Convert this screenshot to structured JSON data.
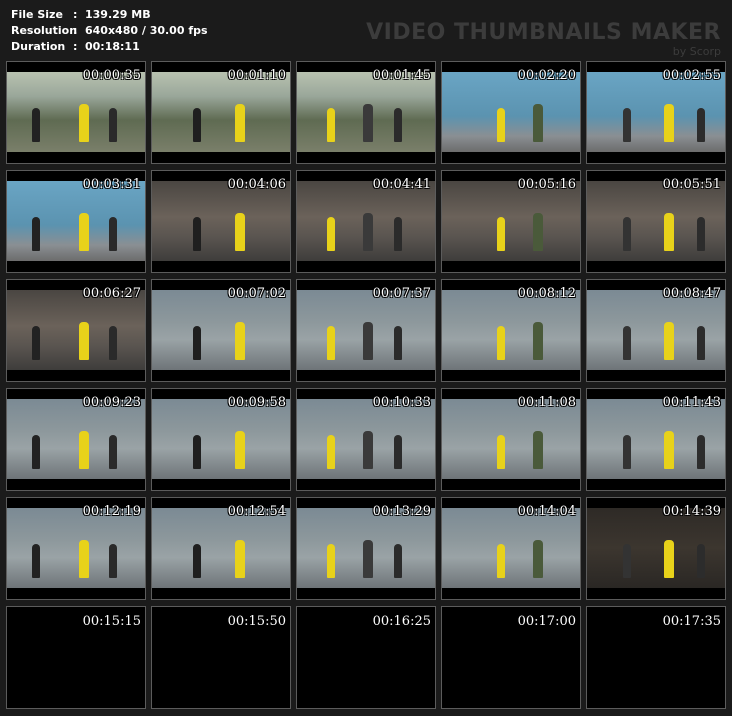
{
  "info": {
    "file_size_label": "File Size",
    "file_size_value": "139.29 MB",
    "resolution_label": "Resolution",
    "resolution_value": "640x480 / 30.00 fps",
    "duration_label": "Duration",
    "duration_value": "00:18:11",
    "separator": ":"
  },
  "brand": {
    "name": "VIDEO THUMBNAILS MAKER",
    "by": "by Scorp"
  },
  "thumbnails": [
    {
      "time": "00:00:35",
      "scene": "outdoor",
      "has_image": true
    },
    {
      "time": "00:01:10",
      "scene": "outdoor",
      "has_image": true
    },
    {
      "time": "00:01:45",
      "scene": "outdoor",
      "has_image": true
    },
    {
      "time": "00:02:20",
      "scene": "wall",
      "has_image": true
    },
    {
      "time": "00:02:55",
      "scene": "wall",
      "has_image": true
    },
    {
      "time": "00:03:31",
      "scene": "wall",
      "has_image": true
    },
    {
      "time": "00:04:06",
      "scene": "room",
      "has_image": true
    },
    {
      "time": "00:04:41",
      "scene": "room",
      "has_image": true
    },
    {
      "time": "00:05:16",
      "scene": "room",
      "has_image": true
    },
    {
      "time": "00:05:51",
      "scene": "room",
      "has_image": true
    },
    {
      "time": "00:06:27",
      "scene": "room",
      "has_image": true
    },
    {
      "time": "00:07:02",
      "scene": "hall",
      "has_image": true
    },
    {
      "time": "00:07:37",
      "scene": "hall",
      "has_image": true
    },
    {
      "time": "00:08:12",
      "scene": "hall",
      "has_image": true
    },
    {
      "time": "00:08:47",
      "scene": "hall",
      "has_image": true
    },
    {
      "time": "00:09:23",
      "scene": "hall",
      "has_image": true
    },
    {
      "time": "00:09:58",
      "scene": "hall",
      "has_image": true
    },
    {
      "time": "00:10:33",
      "scene": "hall",
      "has_image": true
    },
    {
      "time": "00:11:08",
      "scene": "hall",
      "has_image": true
    },
    {
      "time": "00:11:43",
      "scene": "hall",
      "has_image": true
    },
    {
      "time": "00:12:19",
      "scene": "hall",
      "has_image": true
    },
    {
      "time": "00:12:54",
      "scene": "hall",
      "has_image": true
    },
    {
      "time": "00:13:29",
      "scene": "hall",
      "has_image": true
    },
    {
      "time": "00:14:04",
      "scene": "hall",
      "has_image": true
    },
    {
      "time": "00:14:39",
      "scene": "dark",
      "has_image": true
    },
    {
      "time": "00:15:15",
      "scene": "none",
      "has_image": false
    },
    {
      "time": "00:15:50",
      "scene": "none",
      "has_image": false
    },
    {
      "time": "00:16:25",
      "scene": "none",
      "has_image": false
    },
    {
      "time": "00:17:00",
      "scene": "none",
      "has_image": false
    },
    {
      "time": "00:17:35",
      "scene": "none",
      "has_image": false
    }
  ],
  "colors": {
    "background": "#1b1b1b",
    "thumb_border": "#5c5c5c",
    "brand_text": "#3c3c3c",
    "accent_yellow": "#e8d21a"
  }
}
